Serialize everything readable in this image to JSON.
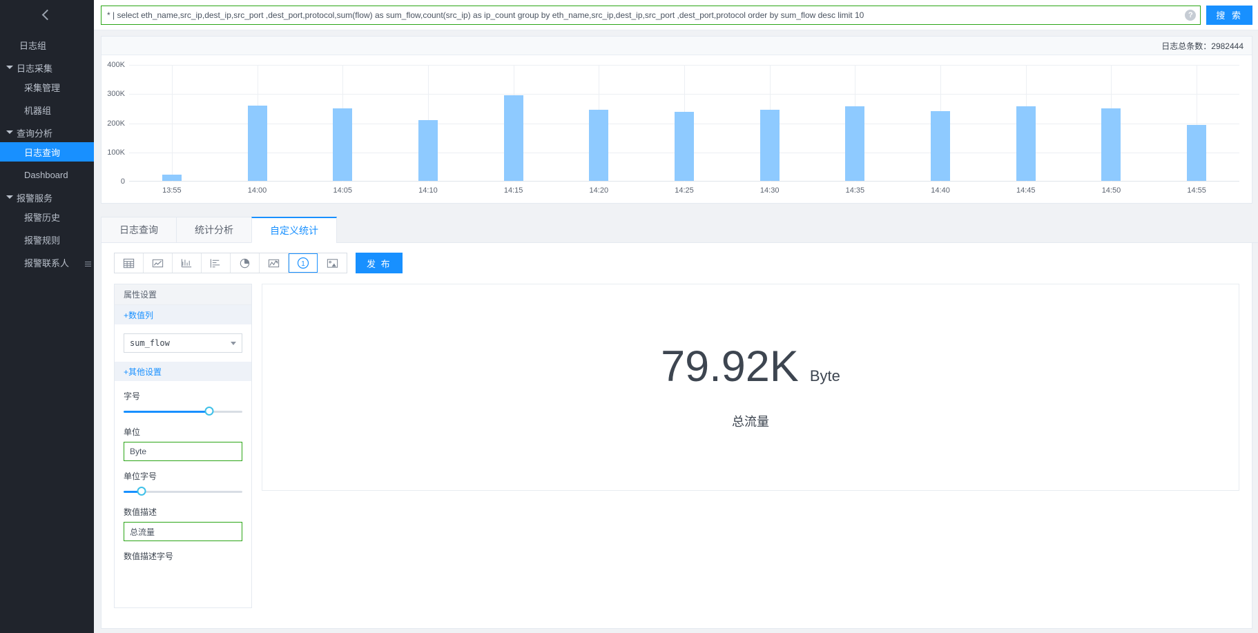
{
  "sidebar": {
    "collapse_icon": "chevron-left-icon",
    "items": [
      {
        "label": "日志组",
        "type": "top",
        "active": false
      },
      {
        "label": "日志采集",
        "type": "group",
        "active": false
      },
      {
        "label": "采集管理",
        "type": "leaf",
        "active": false
      },
      {
        "label": "机器组",
        "type": "leaf",
        "active": false
      },
      {
        "label": "查询分析",
        "type": "group",
        "active": false
      },
      {
        "label": "日志查询",
        "type": "leaf",
        "active": true
      },
      {
        "label": "Dashboard",
        "type": "leaf",
        "active": false
      },
      {
        "label": "报警服务",
        "type": "group",
        "active": false
      },
      {
        "label": "报警历史",
        "type": "leaf",
        "active": false
      },
      {
        "label": "报警规则",
        "type": "leaf",
        "active": false
      },
      {
        "label": "报警联系人",
        "type": "leaf",
        "active": false
      }
    ],
    "handle_icon": "drag-handle-icon"
  },
  "query": {
    "value": "* | select eth_name,src_ip,dest_ip,src_port ,dest_port,protocol,sum(flow) as sum_flow,count(src_ip) as ip_count group by eth_name,src_ip,dest_ip,src_port ,dest_port,protocol order by sum_flow desc limit 10",
    "placeholder": "",
    "help_icon": "question-circle-icon",
    "search_label": "搜 索"
  },
  "chart_header": {
    "total_label": "日志总条数：2982444"
  },
  "chart_data": {
    "type": "bar",
    "title": "",
    "xlabel": "",
    "ylabel": "",
    "ylim": [
      0,
      400000
    ],
    "yticks": [
      0,
      100000,
      200000,
      300000,
      400000
    ],
    "ytick_labels": [
      "0",
      "100K",
      "200K",
      "300K",
      "400K"
    ],
    "grid": true,
    "legend": "none",
    "bar_color": "#8ecaff",
    "categories": [
      "13:55",
      "14:00",
      "14:05",
      "14:10",
      "14:15",
      "14:20",
      "14:25",
      "14:30",
      "14:35",
      "14:40",
      "14:45",
      "14:50",
      "14:55"
    ],
    "values": [
      22000,
      257000,
      249000,
      208000,
      293000,
      243000,
      237000,
      244000,
      255000,
      240000,
      256000,
      248000,
      191000
    ]
  },
  "tabs": [
    {
      "label": "日志查询",
      "active": false
    },
    {
      "label": "统计分析",
      "active": false
    },
    {
      "label": "自定义统计",
      "active": true
    }
  ],
  "toolbar": {
    "icons": [
      {
        "name": "table-icon",
        "active": false
      },
      {
        "name": "line-chart-icon",
        "active": false
      },
      {
        "name": "column-chart-icon",
        "active": false
      },
      {
        "name": "bar-chart-icon",
        "active": false
      },
      {
        "name": "pie-chart-icon",
        "active": false
      },
      {
        "name": "area-chart-icon",
        "active": false
      },
      {
        "name": "single-value-icon",
        "active": true
      },
      {
        "name": "map-chart-icon",
        "active": false
      }
    ],
    "publish_label": "发 布"
  },
  "settings": {
    "title": "属性设置",
    "section_numeric": "+数值列",
    "numeric_column": "sum_flow",
    "section_other": "+其他设置",
    "font_size_label": "字号",
    "font_size_percent": 72,
    "unit_label": "单位",
    "unit_value": "Byte",
    "unit_font_size_label": "单位字号",
    "unit_font_size_percent": 15,
    "value_desc_label": "数值描述",
    "value_desc_value": "总流量",
    "value_desc_font_label": "数值描述字号"
  },
  "preview": {
    "value": "79.92K",
    "unit": "Byte",
    "description": "总流量"
  },
  "colors": {
    "accent": "#1890ff",
    "bar": "#8ecaff",
    "input_border_green": "#2aa515",
    "sidebar_bg": "#20242c"
  }
}
